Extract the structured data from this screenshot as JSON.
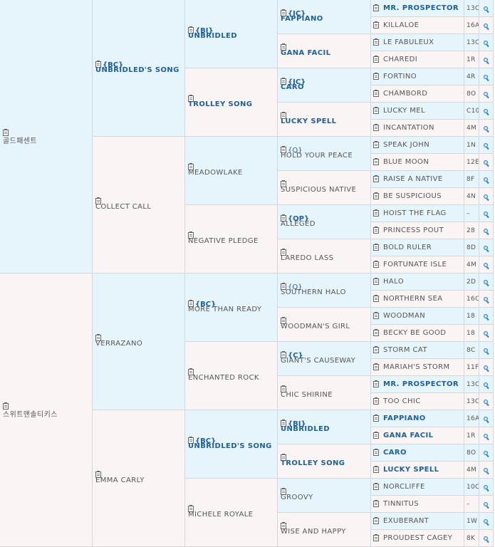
{
  "gen1": [
    {
      "name": "골드패센트",
      "bold": false
    },
    {
      "name": "스위트맨솔티키스",
      "bold": false
    }
  ],
  "gen2": [
    {
      "name": "UNBRIDLED'S SONG",
      "cat": "{BC}",
      "catBold": true,
      "bold": true
    },
    {
      "name": "COLLECT CALL",
      "cat": "",
      "bold": false
    },
    {
      "name": "VERRAZANO",
      "cat": "",
      "bold": false
    },
    {
      "name": "EMMA CARLY",
      "cat": "",
      "bold": false
    }
  ],
  "gen3": [
    {
      "name": "UNBRIDLED",
      "cat": "{BI}",
      "catBold": true,
      "bold": true
    },
    {
      "name": "TROLLEY SONG",
      "cat": "",
      "bold": true
    },
    {
      "name": "MEADOWLAKE",
      "cat": "",
      "bold": false
    },
    {
      "name": "NEGATIVE PLEDGE",
      "cat": "",
      "bold": false
    },
    {
      "name": "MORE THAN READY",
      "cat": "{BC}",
      "catBold": true,
      "bold": false
    },
    {
      "name": "ENCHANTED ROCK",
      "cat": "",
      "bold": false
    },
    {
      "name": "UNBRIDLED'S SONG",
      "cat": "{BC}",
      "catBold": true,
      "bold": true
    },
    {
      "name": "MICHELE ROYALE",
      "cat": "",
      "bold": false
    }
  ],
  "gen4": [
    {
      "name": "FAPPIANO",
      "cat": "{IC}",
      "catBold": true,
      "bold": true
    },
    {
      "name": "GANA FACIL",
      "cat": "",
      "bold": true
    },
    {
      "name": "CARO",
      "cat": "{IC}",
      "catBold": true,
      "bold": true
    },
    {
      "name": "LUCKY SPELL",
      "cat": "",
      "bold": true
    },
    {
      "name": "HOLD YOUR PEACE",
      "cat": "{Q}",
      "catBold": false,
      "bold": false
    },
    {
      "name": "SUSPICIOUS NATIVE",
      "cat": "",
      "bold": false
    },
    {
      "name": "ALLEGED",
      "cat": "{OP}",
      "catBold": true,
      "bold": false
    },
    {
      "name": "LAREDO LASS",
      "cat": "",
      "bold": false
    },
    {
      "name": "SOUTHERN HALO",
      "cat": "{Q}",
      "catBold": false,
      "bold": false
    },
    {
      "name": "WOODMAN'S GIRL",
      "cat": "",
      "bold": false
    },
    {
      "name": "GIANT'S CAUSEWAY",
      "cat": "{C}",
      "catBold": true,
      "bold": false
    },
    {
      "name": "CHIC SHIRINE",
      "cat": "",
      "bold": false
    },
    {
      "name": "UNBRIDLED",
      "cat": "{BI}",
      "catBold": true,
      "bold": true
    },
    {
      "name": "TROLLEY SONG",
      "cat": "",
      "bold": true
    },
    {
      "name": "GROOVY",
      "cat": "",
      "bold": false
    },
    {
      "name": "WISE AND HAPPY",
      "cat": "",
      "bold": false
    }
  ],
  "gen5": [
    {
      "name": "MR. PROSPECTOR",
      "code": "13C",
      "bold": true
    },
    {
      "name": "KILLALOE",
      "code": "16A",
      "bold": false
    },
    {
      "name": "LE FABULEUX",
      "code": "13C",
      "bold": false
    },
    {
      "name": "CHAREDI",
      "code": "1R",
      "bold": false
    },
    {
      "name": "FORTINO",
      "code": "4R",
      "bold": false
    },
    {
      "name": "CHAMBORD",
      "code": "8O",
      "bold": false
    },
    {
      "name": "LUCKY MEL",
      "code": "C10",
      "bold": false
    },
    {
      "name": "INCANTATION",
      "code": "4M",
      "bold": false
    },
    {
      "name": "SPEAK JOHN",
      "code": "1N",
      "bold": false
    },
    {
      "name": "BLUE MOON",
      "code": "12E",
      "bold": false
    },
    {
      "name": "RAISE A NATIVE",
      "code": "8F",
      "bold": false
    },
    {
      "name": "BE SUSPICIOUS",
      "code": "4N",
      "bold": false
    },
    {
      "name": "HOIST THE FLAG",
      "code": "–",
      "bold": false
    },
    {
      "name": "PRINCESS POUT",
      "code": "28",
      "bold": false
    },
    {
      "name": "BOLD RULER",
      "code": "8D",
      "bold": false
    },
    {
      "name": "FORTUNATE ISLE",
      "code": "4M",
      "bold": false
    },
    {
      "name": "HALO",
      "code": "2D",
      "bold": false
    },
    {
      "name": "NORTHERN SEA",
      "code": "16C",
      "bold": false
    },
    {
      "name": "WOODMAN",
      "code": "18",
      "bold": false
    },
    {
      "name": "BECKY BE GOOD",
      "code": "18",
      "bold": false
    },
    {
      "name": "STORM CAT",
      "code": "8C",
      "bold": false
    },
    {
      "name": "MARIAH'S STORM",
      "code": "11F",
      "bold": false
    },
    {
      "name": "MR. PROSPECTOR",
      "code": "13C",
      "bold": true
    },
    {
      "name": "TOO CHIC",
      "code": "13C",
      "bold": false
    },
    {
      "name": "FAPPIANO",
      "code": "16A",
      "bold": true
    },
    {
      "name": "GANA FACIL",
      "code": "1R",
      "bold": true
    },
    {
      "name": "CARO",
      "code": "8O",
      "bold": true
    },
    {
      "name": "LUCKY SPELL",
      "code": "4M",
      "bold": true
    },
    {
      "name": "NORCLIFFE",
      "code": "10C",
      "bold": false
    },
    {
      "name": "TINNITUS",
      "code": "–",
      "bold": false
    },
    {
      "name": "EXUBERANT",
      "code": "1W",
      "bold": false
    },
    {
      "name": "PROUDEST CAGEY",
      "code": "8K",
      "bold": false
    }
  ],
  "icons": {
    "document": "clipboard-icon",
    "search": "magnifier-icon"
  },
  "colors": {
    "blue_bg": "#e6f4fb",
    "pink_bg": "#fbf4f4",
    "link": "#1f5f93",
    "search_icon": "#2a7fc1"
  }
}
